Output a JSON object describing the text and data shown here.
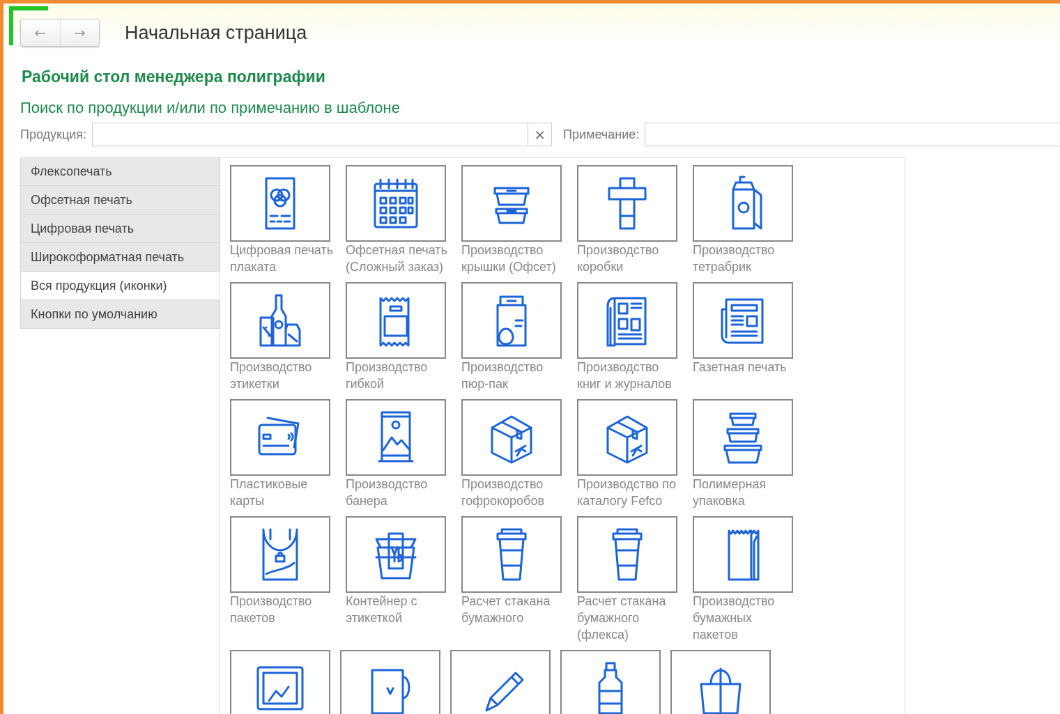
{
  "window": {
    "title": "Начальная страница",
    "back_button": "←",
    "forward_button": "→"
  },
  "heading": "Рабочий стол менеджера полиграфии",
  "search": {
    "caption": "Поиск по продукции и/или по примечанию в шаблоне",
    "fields": [
      {
        "label": "Продукция:",
        "clear_button": "×"
      },
      {
        "label": "Примечание:"
      }
    ]
  },
  "sidebar": {
    "items": [
      {
        "label": "Флексопечать",
        "selected": false
      },
      {
        "label": "Офсетная печать",
        "selected": false
      },
      {
        "label": "Цифровая печать",
        "selected": false
      },
      {
        "label": "Широкоформатная печать",
        "selected": false
      },
      {
        "label": "Вся продукция (иконки)",
        "selected": true
      },
      {
        "label": "Кнопки по умолчанию",
        "selected": false
      }
    ]
  },
  "tiles": [
    [
      {
        "kind": "poster",
        "label": "Цифровая печать плаката"
      },
      {
        "kind": "calendar",
        "label": "Офсетная печать (Сложный заказ)"
      },
      {
        "kind": "food-container",
        "label": "Производство крышки (Офсет)"
      },
      {
        "kind": "box-net",
        "label": "Производство коробки"
      },
      {
        "kind": "carton-with-straw",
        "label": "Производство тетрабрик"
      }
    ],
    [
      {
        "kind": "bottles",
        "label": "Производство этикетки"
      },
      {
        "kind": "pouch",
        "label": "Производство гибкой"
      },
      {
        "kind": "package",
        "label": "Производство пюр-пак"
      },
      {
        "kind": "magazine",
        "label": "Производство книг и журналов"
      },
      {
        "kind": "newspaper",
        "label": "Газетная печать"
      }
    ],
    [
      {
        "kind": "cards",
        "label": "Пластиковые карты"
      },
      {
        "kind": "roll-up-banner",
        "label": "Производство банера"
      },
      {
        "kind": "parcel",
        "label": "Производство гофрокоробов"
      },
      {
        "kind": "parcel",
        "label": "Производство по каталогу Fefco"
      },
      {
        "kind": "container-stack",
        "label": "Полимерная упаковка"
      }
    ],
    [
      {
        "kind": "plastic-bag",
        "label": "Производство пакетов"
      },
      {
        "kind": "takeaway-box",
        "label": "Контейнер с этикеткой"
      },
      {
        "kind": "paper-cup",
        "label": "Расчет стакана бумажного"
      },
      {
        "kind": "paper-cup",
        "label": "Расчет стакана бумажного (флекса)"
      },
      {
        "kind": "paper-bag",
        "label": "Производство бумажных пакетов"
      }
    ],
    [
      {
        "kind": "picture-frame"
      },
      {
        "kind": "mug"
      },
      {
        "kind": "pen"
      },
      {
        "kind": "bottle"
      },
      {
        "kind": "handbag"
      }
    ]
  ]
}
